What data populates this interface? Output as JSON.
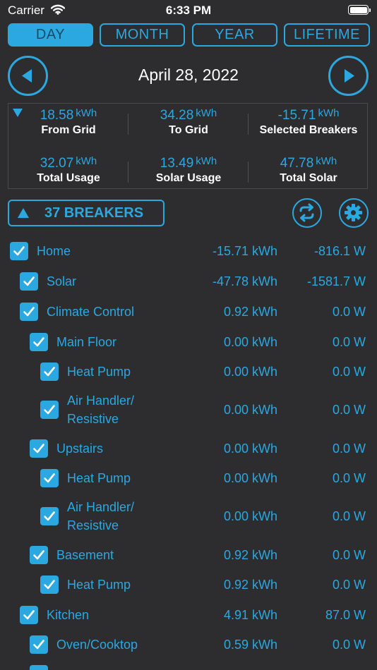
{
  "status": {
    "carrier": "Carrier",
    "time": "6:33 PM"
  },
  "tabs": [
    {
      "label": "DAY",
      "active": true
    },
    {
      "label": "MONTH",
      "active": false
    },
    {
      "label": "YEAR",
      "active": false
    },
    {
      "label": "LIFETIME",
      "active": false
    }
  ],
  "date_title": "April 28, 2022",
  "summary": {
    "cells": [
      {
        "value": "18.58",
        "unit": "kWh",
        "label": "From Grid"
      },
      {
        "value": "34.28",
        "unit": "kWh",
        "label": "To Grid"
      },
      {
        "value": "-15.71",
        "unit": "kWh",
        "label": "Selected Breakers"
      },
      {
        "value": "32.07",
        "unit": "kWh",
        "label": "Total Usage"
      },
      {
        "value": "13.49",
        "unit": "kWh",
        "label": "Solar Usage"
      },
      {
        "value": "47.78",
        "unit": "kWh",
        "label": "Total Solar"
      }
    ]
  },
  "breakers_button": {
    "label": "37 BREAKERS"
  },
  "colors": {
    "accent": "#2ba8e0",
    "background": "#2d2d2f",
    "text": "#ffffff"
  },
  "breakers": [
    {
      "name": "Home",
      "kwh": "-15.71 kWh",
      "watts": "-816.1 W",
      "checked": true
    },
    {
      "name": "Solar",
      "kwh": "-47.78 kWh",
      "watts": "-1581.7 W",
      "checked": true
    },
    {
      "name": "Climate Control",
      "kwh": "0.92 kWh",
      "watts": "0.0 W",
      "checked": true
    },
    {
      "name": "Main Floor",
      "kwh": "0.00 kWh",
      "watts": "0.0 W",
      "checked": true
    },
    {
      "name": "Heat Pump",
      "kwh": "0.00 kWh",
      "watts": "0.0 W",
      "checked": true
    },
    {
      "name": "Air Handler/ Resistive",
      "kwh": "0.00 kWh",
      "watts": "0.0 W",
      "checked": true
    },
    {
      "name": "Upstairs",
      "kwh": "0.00 kWh",
      "watts": "0.0 W",
      "checked": true
    },
    {
      "name": "Heat Pump",
      "kwh": "0.00 kWh",
      "watts": "0.0 W",
      "checked": true
    },
    {
      "name": "Air Handler/ Resistive",
      "kwh": "0.00 kWh",
      "watts": "0.0 W",
      "checked": true
    },
    {
      "name": "Basement",
      "kwh": "0.92 kWh",
      "watts": "0.0 W",
      "checked": true
    },
    {
      "name": "Heat Pump",
      "kwh": "0.92 kWh",
      "watts": "0.0 W",
      "checked": true
    },
    {
      "name": "Kitchen",
      "kwh": "4.91 kWh",
      "watts": "87.0 W",
      "checked": true
    },
    {
      "name": "Oven/Cooktop",
      "kwh": "0.59 kWh",
      "watts": "0.0 W",
      "checked": true
    }
  ]
}
